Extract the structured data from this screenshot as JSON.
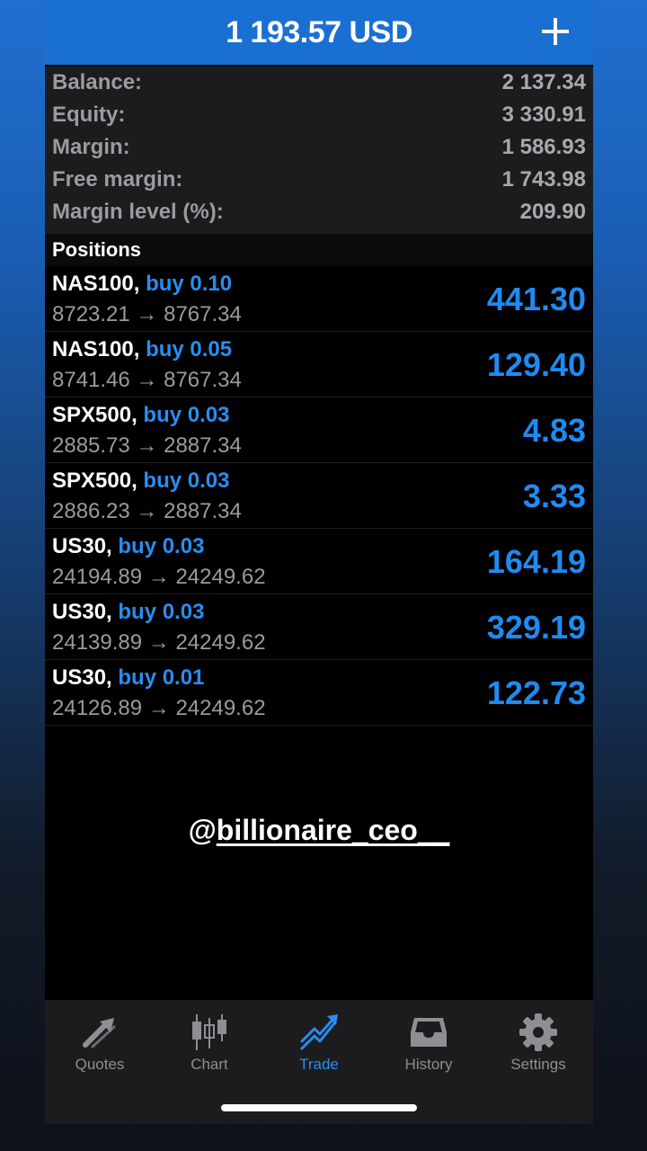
{
  "header": {
    "title": "1 193.57 USD",
    "add_icon": "plus-icon"
  },
  "summary": [
    {
      "label": "Balance:",
      "value": "2 137.34"
    },
    {
      "label": "Equity:",
      "value": "3 330.91"
    },
    {
      "label": "Margin:",
      "value": "1 586.93"
    },
    {
      "label": "Free margin:",
      "value": "1 743.98"
    },
    {
      "label": "Margin level (%):",
      "value": "209.90"
    }
  ],
  "positions_title": "Positions",
  "positions": [
    {
      "symbol": "NAS100,",
      "side": "buy 0.10",
      "prices": "8723.21 → 8767.34",
      "profit": "441.30"
    },
    {
      "symbol": "NAS100,",
      "side": "buy 0.05",
      "prices": "8741.46 → 8767.34",
      "profit": "129.40"
    },
    {
      "symbol": "SPX500,",
      "side": "buy 0.03",
      "prices": "2885.73 → 2887.34",
      "profit": "4.83"
    },
    {
      "symbol": "SPX500,",
      "side": "buy 0.03",
      "prices": "2886.23 → 2887.34",
      "profit": "3.33"
    },
    {
      "symbol": "US30,",
      "side": "buy 0.03",
      "prices": "24194.89 → 24249.62",
      "profit": "164.19"
    },
    {
      "symbol": "US30,",
      "side": "buy 0.03",
      "prices": "24139.89 → 24249.62",
      "profit": "329.19"
    },
    {
      "symbol": "US30,",
      "side": "buy 0.01",
      "prices": "24126.89 → 24249.62",
      "profit": "122.73"
    }
  ],
  "watermark": {
    "at": "@",
    "handle": "billionaire_ceo__"
  },
  "tabs": [
    {
      "label": "Quotes",
      "icon": "quotes-arrows-icon",
      "active": false
    },
    {
      "label": "Chart",
      "icon": "candlestick-chart-icon",
      "active": false
    },
    {
      "label": "Trade",
      "icon": "trade-trend-icon",
      "active": true
    },
    {
      "label": "History",
      "icon": "inbox-history-icon",
      "active": false
    },
    {
      "label": "Settings",
      "icon": "gear-icon",
      "active": false
    }
  ],
  "colors": {
    "accent": "#1f8bf2",
    "header": "#1a6fd3",
    "panel": "#1c1c1e"
  }
}
